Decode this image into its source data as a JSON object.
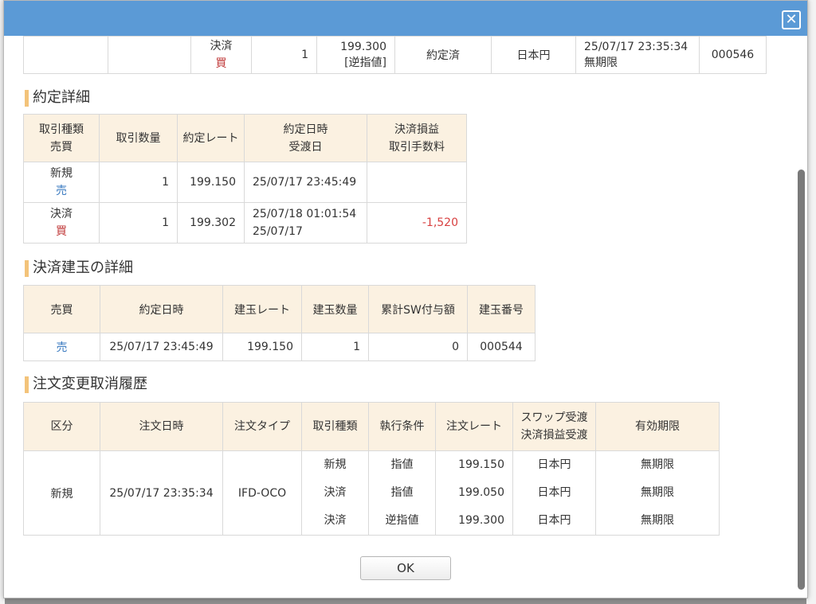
{
  "modal": {
    "close_glyph": "✕",
    "ok_label": "OK"
  },
  "top_row": {
    "type": "決済",
    "side": "買",
    "qty": "1",
    "rate": "199.300",
    "rate_note": "[逆指値]",
    "status": "約定済",
    "currency": "日本円",
    "datetime": "25/07/17 23:35:34",
    "expiry": "無期限",
    "number": "000546"
  },
  "execution": {
    "title": "約定詳細",
    "headers": {
      "type_line1": "取引種類",
      "type_line2": "売買",
      "qty": "取引数量",
      "rate": "約定レート",
      "dt_line1": "約定日時",
      "dt_line2": "受渡日",
      "pl_line1": "決済損益",
      "pl_line2": "取引手数料"
    },
    "rows": [
      {
        "type": "新規",
        "side": "売",
        "qty": "1",
        "rate": "199.150",
        "dt": "25/07/17 23:45:49",
        "settle": "",
        "pl": ""
      },
      {
        "type": "決済",
        "side": "買",
        "qty": "1",
        "rate": "199.302",
        "dt": "25/07/18 01:01:54",
        "settle": "25/07/17",
        "pl": "-1,520"
      }
    ]
  },
  "positions": {
    "title": "決済建玉の詳細",
    "headers": {
      "side": "売買",
      "dt": "約定日時",
      "rate": "建玉レート",
      "qty": "建玉数量",
      "sw": "累計SW付与額",
      "no": "建玉番号"
    },
    "row": {
      "side": "売",
      "dt": "25/07/17 23:45:49",
      "rate": "199.150",
      "qty": "1",
      "sw": "0",
      "no": "000544"
    }
  },
  "history": {
    "title": "注文変更取消履歴",
    "headers": {
      "kubun": "区分",
      "dt": "注文日時",
      "type": "注文タイプ",
      "trade": "取引種類",
      "cond": "執行条件",
      "rate": "注文レート",
      "swap_line1": "スワップ受渡",
      "swap_line2": "決済損益受渡",
      "expiry": "有効期限"
    },
    "row": {
      "kubun": "新規",
      "dt": "25/07/17 23:35:34",
      "type": "IFD-OCO",
      "legs": [
        {
          "trade": "新規",
          "cond": "指値",
          "rate": "199.150",
          "swap": "日本円",
          "expiry": "無期限"
        },
        {
          "trade": "決済",
          "cond": "指値",
          "rate": "199.050",
          "swap": "日本円",
          "expiry": "無期限"
        },
        {
          "trade": "決済",
          "cond": "逆指値",
          "rate": "199.300",
          "swap": "日本円",
          "expiry": "無期限"
        }
      ]
    }
  }
}
